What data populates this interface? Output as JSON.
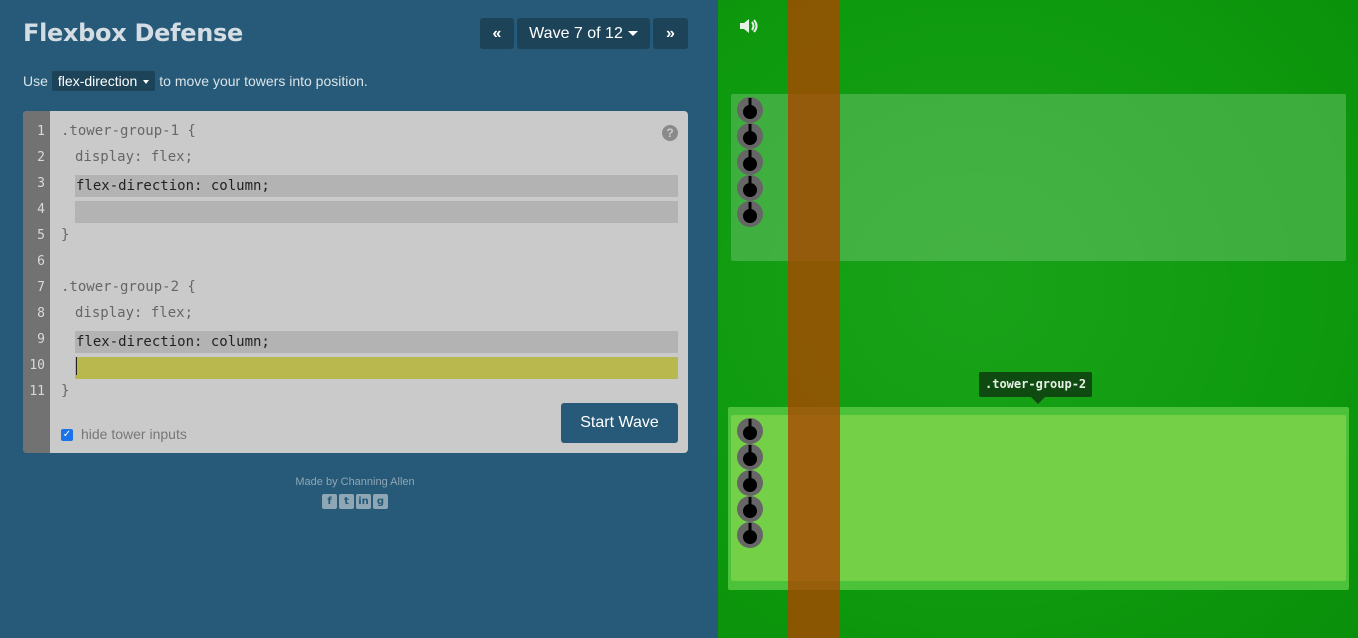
{
  "header": {
    "title": "Flexbox Defense",
    "prev_label": "«",
    "wave_label": "Wave 7 of 12",
    "next_label": "»"
  },
  "instructions": {
    "prefix": "Use",
    "property": "flex-direction",
    "suffix": "to move your towers into position."
  },
  "editor": {
    "line_numbers": [
      "1",
      "2",
      "3",
      "4",
      "5",
      "6",
      "7",
      "8",
      "9",
      "10",
      "11"
    ],
    "line1": ".tower-group-1 {",
    "line2": "display: flex;",
    "line3_input": "flex-direction: column;",
    "line4_input": "",
    "line5": "}",
    "line7": ".tower-group-2 {",
    "line8": "display: flex;",
    "line9_input": "flex-direction: column;",
    "line10_input": "",
    "line11": "}",
    "help_label": "?",
    "hide_inputs_label": "hide tower inputs",
    "hide_inputs_checked": true,
    "start_button": "Start Wave"
  },
  "footer": {
    "credit": "Made by Channing Allen",
    "socials": [
      "facebook-icon",
      "twitter-icon",
      "linkedin-icon",
      "github-icon"
    ]
  },
  "game": {
    "tooltip": ".tower-group-2",
    "colors": {
      "grass": "#0e9a0e",
      "road": "#aa4600",
      "group_highlight": "#4cc13a",
      "tooltip_bg": "#0f4a10"
    }
  }
}
